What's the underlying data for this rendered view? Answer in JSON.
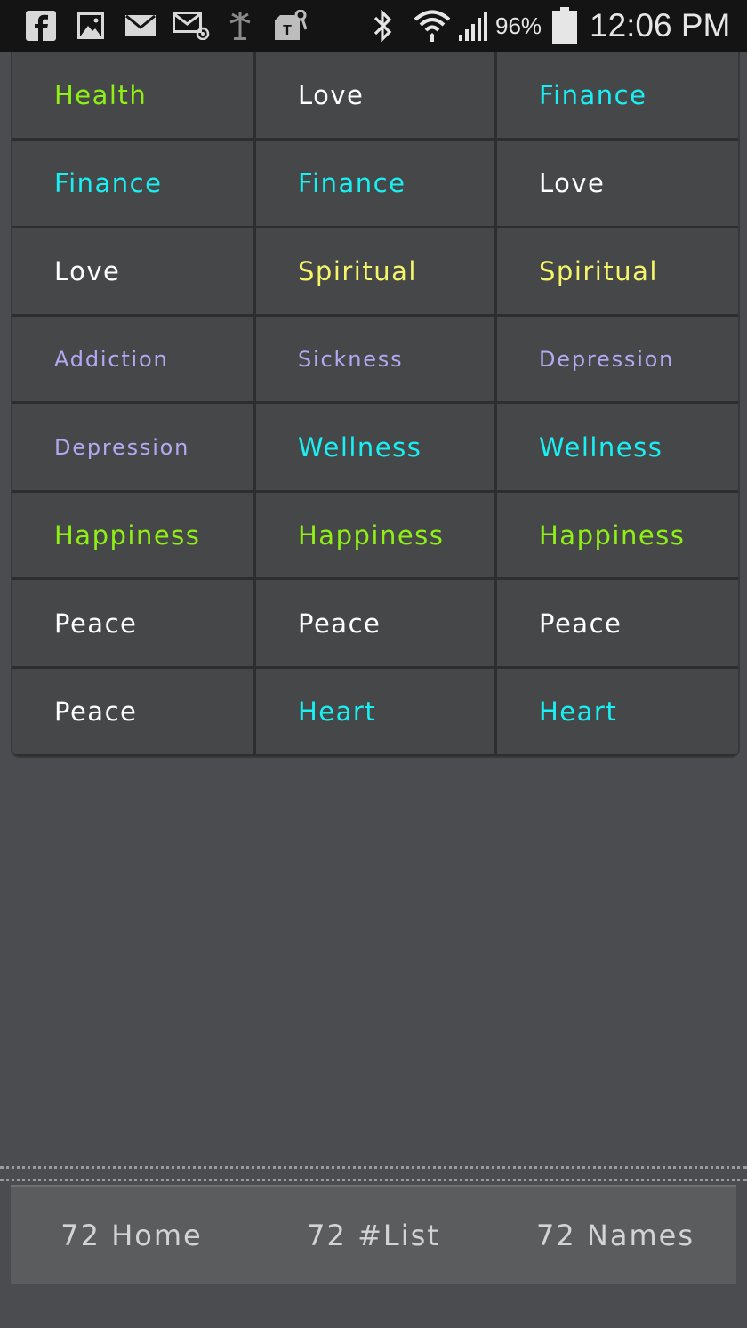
{
  "status_bar": {
    "icons": [
      "facebook-icon",
      "gallery-icon",
      "email-icon",
      "email-alert-icon",
      "palm-tree-icon",
      "tmobile-icon",
      "bluetooth-icon",
      "wifi-icon",
      "signal-icon",
      "battery-icon"
    ],
    "battery_percent": "96%",
    "time": "12:06 PM"
  },
  "colors": {
    "green": "#8ff015",
    "white": "#ffffff",
    "cyan": "#19f0f3",
    "yellow": "#f5f56a",
    "lavender": "#b4a8f3"
  },
  "grid": {
    "rows": [
      [
        {
          "label": "Health",
          "color": "green"
        },
        {
          "label": "Love",
          "color": "white"
        },
        {
          "label": "Finance",
          "color": "cyan"
        }
      ],
      [
        {
          "label": "Finance",
          "color": "cyan"
        },
        {
          "label": "Finance",
          "color": "cyan"
        },
        {
          "label": "Love",
          "color": "white"
        }
      ],
      [
        {
          "label": "Love",
          "color": "white"
        },
        {
          "label": "Spiritual",
          "color": "yellow"
        },
        {
          "label": "Spiritual",
          "color": "yellow"
        }
      ],
      [
        {
          "label": "Addiction",
          "color": "lavender"
        },
        {
          "label": "Sickness",
          "color": "lavender"
        },
        {
          "label": "Depression",
          "color": "lavender"
        }
      ],
      [
        {
          "label": "Depression",
          "color": "lavender"
        },
        {
          "label": "Wellness",
          "color": "cyan"
        },
        {
          "label": "Wellness",
          "color": "cyan"
        }
      ],
      [
        {
          "label": "Happiness",
          "color": "green"
        },
        {
          "label": "Happiness",
          "color": "green"
        },
        {
          "label": "Happiness",
          "color": "green"
        }
      ],
      [
        {
          "label": "Peace",
          "color": "white"
        },
        {
          "label": "Peace",
          "color": "white"
        },
        {
          "label": "Peace",
          "color": "white"
        }
      ],
      [
        {
          "label": "Peace",
          "color": "white"
        },
        {
          "label": "Heart",
          "color": "cyan"
        },
        {
          "label": "Heart",
          "color": "cyan"
        }
      ]
    ]
  },
  "tabs": [
    {
      "label": "72 Home"
    },
    {
      "label": "72 #List"
    },
    {
      "label": "72 Names"
    }
  ]
}
